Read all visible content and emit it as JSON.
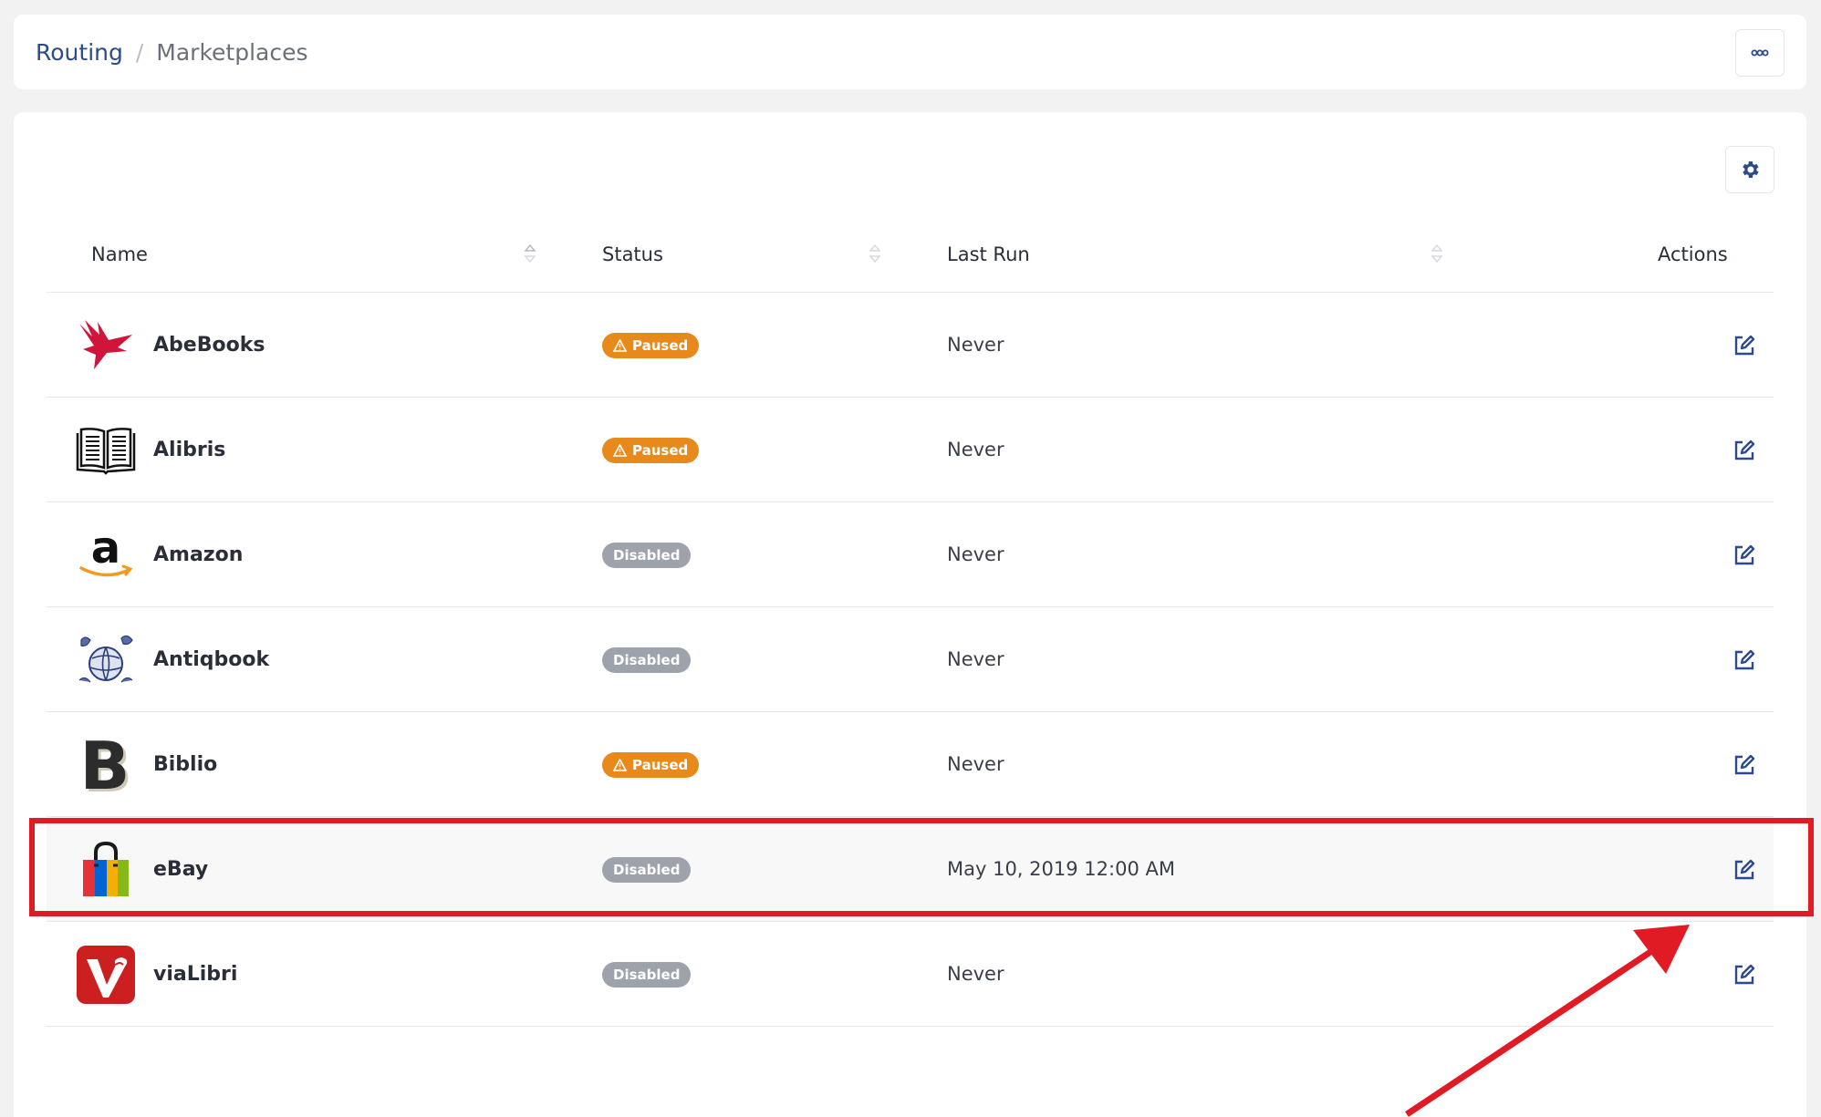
{
  "breadcrumb": {
    "root": "Routing",
    "separator": "/",
    "current": "Marketplaces"
  },
  "header": {
    "more_icon": "more-horizontal-icon"
  },
  "toolbar": {
    "settings_icon": "gear-icon"
  },
  "table": {
    "columns": {
      "name": "Name",
      "status": "Status",
      "last_run": "Last Run",
      "actions": "Actions"
    },
    "rows": [
      {
        "name": "AbeBooks",
        "status": "Paused",
        "last_run": "Never",
        "logo": "abebooks-logo"
      },
      {
        "name": "Alibris",
        "status": "Paused",
        "last_run": "Never",
        "logo": "alibris-logo"
      },
      {
        "name": "Amazon",
        "status": "Disabled",
        "last_run": "Never",
        "logo": "amazon-logo"
      },
      {
        "name": "Antiqbook",
        "status": "Disabled",
        "last_run": "Never",
        "logo": "antiqbook-logo"
      },
      {
        "name": "Biblio",
        "status": "Paused",
        "last_run": "Never",
        "logo": "biblio-logo"
      },
      {
        "name": "eBay",
        "status": "Disabled",
        "last_run": "May 10, 2019 12:00 AM",
        "logo": "ebay-logo",
        "highlighted": true
      },
      {
        "name": "viaLibri",
        "status": "Disabled",
        "last_run": "Never",
        "logo": "vialibri-logo"
      }
    ]
  },
  "colors": {
    "paused": "#e8891c",
    "disabled": "#9ea3ab",
    "link": "#2d4a8a",
    "annotation": "#e01b24"
  }
}
